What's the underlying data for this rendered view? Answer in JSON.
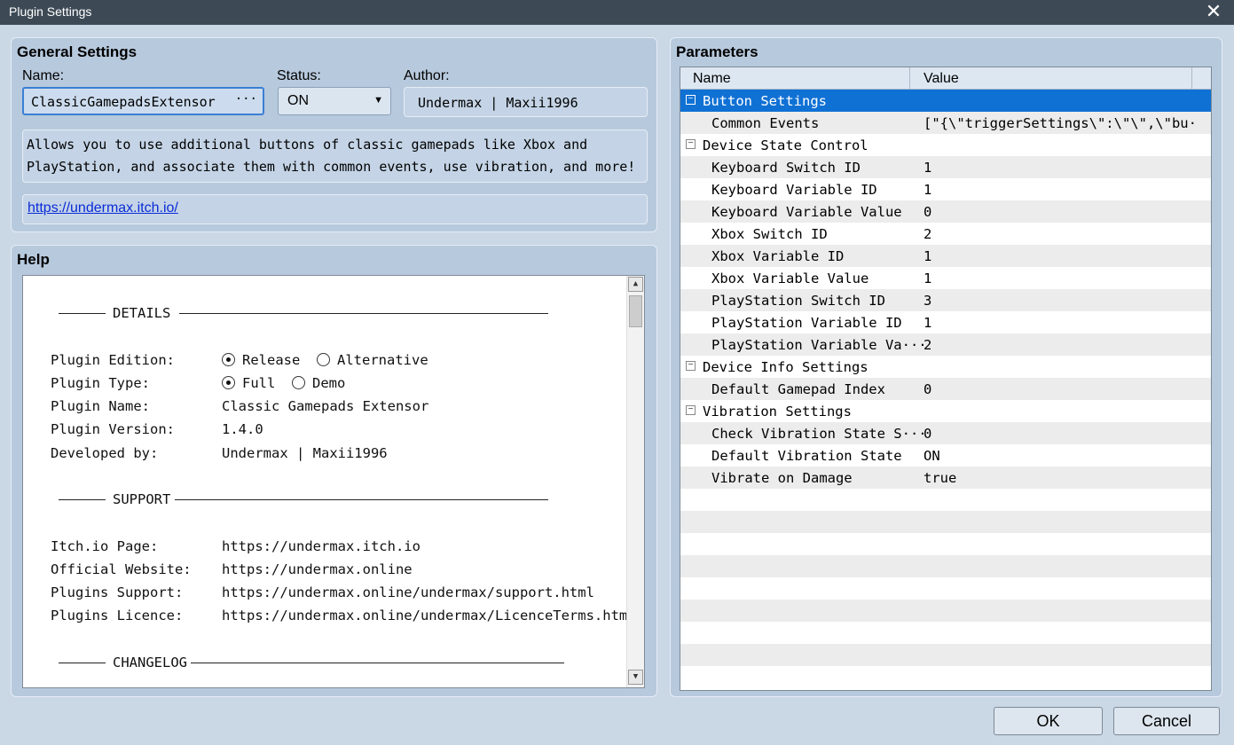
{
  "window": {
    "title": "Plugin Settings",
    "close_glyph": "✕"
  },
  "general": {
    "title": "General Settings",
    "name_label": "Name:",
    "name_value": "ClassicGamepadsExtensor",
    "name_button": "···",
    "status_label": "Status:",
    "status_value": "ON",
    "author_label": "Author:",
    "author_value": "Undermax | Maxii1996",
    "description": "Allows you to use additional buttons of classic gamepads like Xbox and\nPlayStation, and associate them with common events, use vibration, and more!",
    "link": "https://undermax.itch.io/"
  },
  "help": {
    "title": "Help",
    "sections": {
      "details": "DETAILS",
      "support": "SUPPORT",
      "changelog": "CHANGELOG"
    },
    "details": {
      "edition_label": "Plugin Edition:",
      "edition_opt1": "Release",
      "edition_opt2": "Alternative",
      "type_label": "Plugin Type:",
      "type_opt1": "Full",
      "type_opt2": "Demo",
      "name_label": "Plugin Name:",
      "name_value": "Classic Gamepads Extensor",
      "version_label": "Plugin Version:",
      "version_value": "1.4.0",
      "dev_label": "Developed by:",
      "dev_value": "Undermax | Maxii1996"
    },
    "support": {
      "itch_label": "Itch.io Page:",
      "itch_value": "https://undermax.itch.io",
      "web_label": "Official Website:",
      "web_value": "https://undermax.online",
      "sup_label": "Plugins Support:",
      "sup_value": "https://undermax.online/undermax/support.html",
      "lic_label": "Plugins Licence:",
      "lic_value": "https://undermax.online/undermax/LicenceTerms.html"
    }
  },
  "parameters": {
    "title": "Parameters",
    "col_name": "Name",
    "col_value": "Value",
    "rows": [
      {
        "name": "Button Settings",
        "value": "",
        "group": true
      },
      {
        "name": "Common Events",
        "value": "[\"{\\\"triggerSettings\\\":\\\"\\\",\\\"bu···"
      },
      {
        "name": "Device State Control",
        "value": "",
        "group": true
      },
      {
        "name": "Keyboard Switch ID",
        "value": "1"
      },
      {
        "name": "Keyboard Variable ID",
        "value": "1"
      },
      {
        "name": "Keyboard Variable Value",
        "value": "0"
      },
      {
        "name": "Xbox Switch ID",
        "value": "2"
      },
      {
        "name": "Xbox Variable ID",
        "value": "1"
      },
      {
        "name": "Xbox Variable Value",
        "value": "1"
      },
      {
        "name": "PlayStation Switch ID",
        "value": "3"
      },
      {
        "name": "PlayStation Variable ID",
        "value": "1"
      },
      {
        "name": "PlayStation Variable Va···",
        "value": "2"
      },
      {
        "name": "Device Info Settings",
        "value": "",
        "group": true
      },
      {
        "name": "Default Gamepad Index",
        "value": "0"
      },
      {
        "name": "Vibration Settings",
        "value": "",
        "group": true
      },
      {
        "name": "Check Vibration State S···",
        "value": "0"
      },
      {
        "name": "Default Vibration State",
        "value": "ON"
      },
      {
        "name": "Vibrate on Damage",
        "value": "true"
      }
    ]
  },
  "buttons": {
    "ok": "OK",
    "cancel": "Cancel"
  }
}
